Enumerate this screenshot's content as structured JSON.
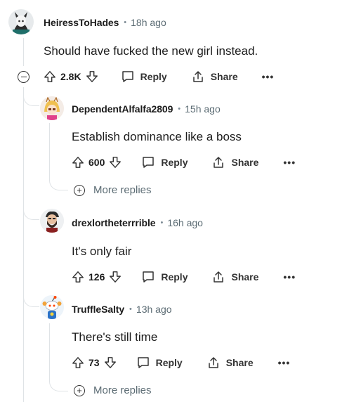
{
  "comments": [
    {
      "author": "HeiressToHades",
      "time": "18h ago",
      "body": "Should have fucked the new girl instead.",
      "votes": "2.8K",
      "reply_label": "Reply",
      "share_label": "Share",
      "more_label": "•••"
    },
    {
      "author": "DependentAlfalfa2809",
      "time": "15h ago",
      "body": "Establish dominance like a boss",
      "votes": "600",
      "reply_label": "Reply",
      "share_label": "Share",
      "more_label": "•••",
      "more_replies": "More replies"
    },
    {
      "author": "drexlortheterrrible",
      "time": "16h ago",
      "body": "It's only fair",
      "votes": "126",
      "reply_label": "Reply",
      "share_label": "Share",
      "more_label": "•••"
    },
    {
      "author": "TruffleSalty",
      "time": "13h ago",
      "body": "There's still time",
      "votes": "73",
      "reply_label": "Reply",
      "share_label": "Share",
      "more_label": "•••",
      "more_replies": "More replies"
    }
  ],
  "separator": "•",
  "collapse_icon": "collapse-minus-icon",
  "colors": {
    "text": "#1c1c1c",
    "meta": "#5c6c74",
    "thread_line": "#dfe3e6"
  }
}
